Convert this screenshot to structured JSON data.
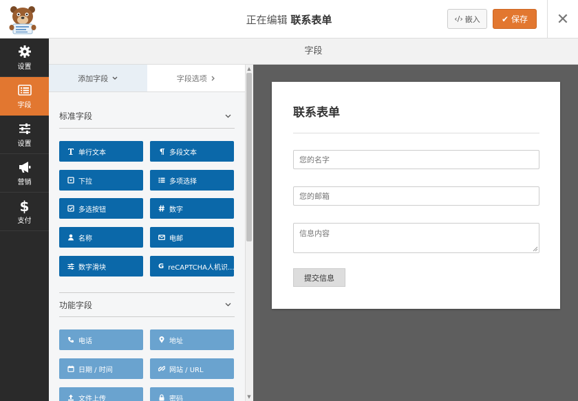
{
  "header": {
    "title_prefix": "正在编辑",
    "form_name": "联系表单",
    "embed_label": "嵌入",
    "save_label": "保存"
  },
  "sidebar": {
    "items": [
      {
        "label": "设置",
        "icon": "gear-icon"
      },
      {
        "label": "字段",
        "icon": "list-icon",
        "active": true
      },
      {
        "label": "设置",
        "icon": "sliders-icon"
      },
      {
        "label": "营销",
        "icon": "megaphone-icon"
      },
      {
        "label": "支付",
        "icon": "dollar-icon"
      }
    ]
  },
  "panel": {
    "heading": "字段",
    "tabs": [
      {
        "label": "添加字段",
        "active": true
      },
      {
        "label": "字段选项",
        "active": false
      }
    ]
  },
  "standard_fields": {
    "heading": "标准字段",
    "buttons": [
      {
        "label": "单行文本",
        "icon": "text-icon"
      },
      {
        "label": "多段文本",
        "icon": "paragraph-icon"
      },
      {
        "label": "下拉",
        "icon": "dropdown-icon"
      },
      {
        "label": "多项选择",
        "icon": "list-bullet-icon"
      },
      {
        "label": "多选按钮",
        "icon": "checkbox-icon"
      },
      {
        "label": "数字",
        "icon": "hash-icon"
      },
      {
        "label": "名称",
        "icon": "user-icon"
      },
      {
        "label": "电邮",
        "icon": "envelope-icon"
      },
      {
        "label": "数字滑块",
        "icon": "sliders-icon"
      },
      {
        "label": "reCAPTCHA人机识...",
        "icon": "google-icon"
      }
    ]
  },
  "fancy_fields": {
    "heading": "功能字段",
    "buttons": [
      {
        "label": "电话",
        "icon": "phone-icon"
      },
      {
        "label": "地址",
        "icon": "map-marker-icon"
      },
      {
        "label": "日期 / 时间",
        "icon": "calendar-icon"
      },
      {
        "label": "网站 / URL",
        "icon": "link-icon"
      },
      {
        "label": "文件上传",
        "icon": "upload-icon"
      },
      {
        "label": "密码",
        "icon": "lock-icon"
      }
    ]
  },
  "form_preview": {
    "title": "联系表单",
    "name_placeholder": "您的名字",
    "email_placeholder": "您的邮箱",
    "message_placeholder": "信息内容",
    "submit_label": "提交信息"
  },
  "colors": {
    "accent": "#e27730",
    "field_button": "#0b68a9",
    "field_button_light": "#6aa3cf",
    "sidebar_bg": "#2a2a2a",
    "preview_bg": "#5e5e5e"
  }
}
